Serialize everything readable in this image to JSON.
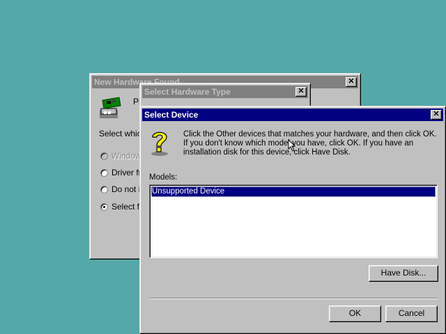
{
  "new_hardware": {
    "title": "New Hardware Found",
    "desc_partial": "Pl",
    "select_which": "Select which",
    "options": [
      {
        "label": "Window",
        "disabled": true,
        "checked": false
      },
      {
        "label": "Driver fro",
        "disabled": false,
        "checked": false
      },
      {
        "label": "Do not in",
        "disabled": false,
        "checked": false
      },
      {
        "label": "Select fr",
        "disabled": false,
        "checked": true
      }
    ]
  },
  "select_hardware_type": {
    "title": "Select Hardware Type"
  },
  "select_device": {
    "title": "Select Device",
    "instructions": "Click the Other devices that matches your hardware, and then click OK. If you don't know which model you have, click OK. If you have an installation disk for this device, click Have Disk.",
    "models_label": "Models:",
    "models": [
      "Unsupported Device"
    ],
    "selected_model": "Unsupported Device",
    "have_disk_label": "Have Disk...",
    "ok_label": "OK",
    "cancel_label": "Cancel"
  },
  "colors": {
    "desktop": "#55a8a8",
    "title_active": "#000080",
    "title_inactive": "#808080",
    "selection": "#000080"
  }
}
